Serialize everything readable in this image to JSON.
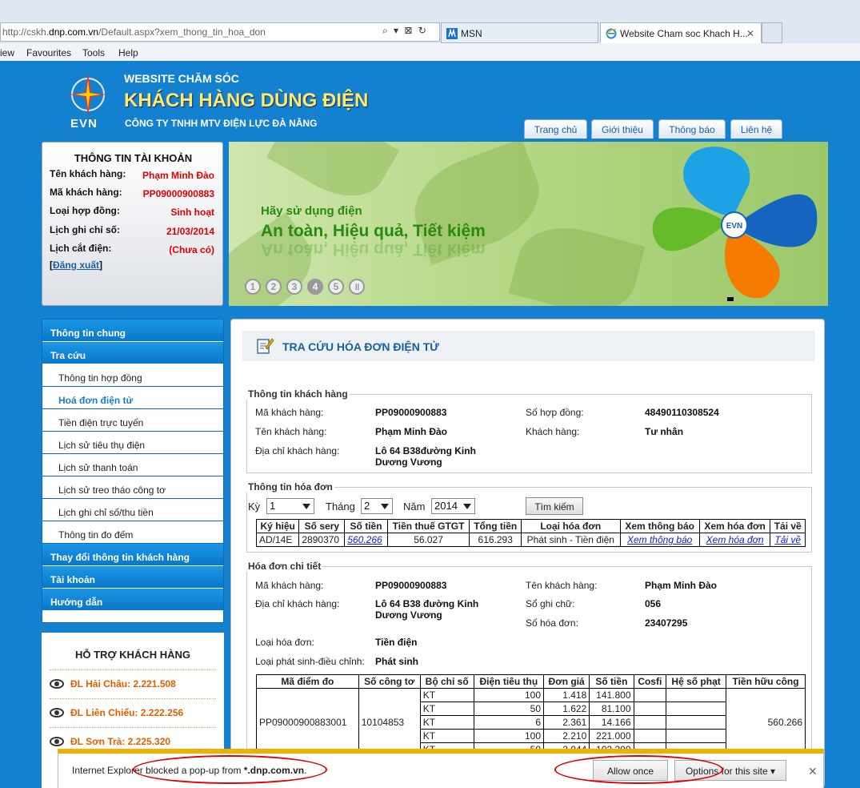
{
  "browser": {
    "address": {
      "prefix": "http://cskh.",
      "domain": "dnp.com.vn",
      "path": "/Default.aspx?xem_thong_tin_hoa_don"
    },
    "address_icons": "⌕ ▾ ⊠ ↻",
    "tabs": [
      {
        "label": "MSN",
        "icon": "msn-icon"
      },
      {
        "label": "Website Cham soc Khach H...",
        "icon": "ie-icon",
        "close": "✕"
      }
    ],
    "menu": [
      "iew",
      "Favourites",
      "Tools",
      "Help"
    ]
  },
  "header": {
    "logo_text": "EVN",
    "line1": "WEBSITE CHĂM SÓC",
    "line2": "KHÁCH HÀNG DÙNG ĐIỆN",
    "line3": "CÔNG TY TNHH MTV ĐIỆN LỰC ĐÀ NẴNG",
    "nav": [
      "Trang chủ",
      "Giới thiệu",
      "Thông báo",
      "Liên hệ"
    ]
  },
  "account": {
    "title": "THÔNG TIN TÀI KHOẢN",
    "rows": [
      {
        "label": "Tên khách hàng:",
        "value": "Phạm Minh Đào"
      },
      {
        "label": "Mã khách hàng:",
        "value": "PP09000900883"
      },
      {
        "label": "Loại hợp đồng:",
        "value": "Sinh hoạt"
      },
      {
        "label": "Lịch ghi chỉ số:",
        "value": "21/03/2014"
      },
      {
        "label": "Lịch cắt điện:",
        "value": "(Chưa có)"
      }
    ],
    "logout_open": "[",
    "logout": "Đăng xuất",
    "logout_close": "]"
  },
  "banner": {
    "line1": "Hãy sử dụng điện",
    "line2": "An toàn, Hiệu quả, Tiết kiệm",
    "dots": [
      "1",
      "2",
      "3",
      "4",
      "5",
      "॥"
    ],
    "active_dot": 4,
    "graphic_center": "EVN"
  },
  "sidebar": {
    "items": [
      {
        "label": "Thông tin chung",
        "type": "head"
      },
      {
        "label": "Tra cứu",
        "type": "head"
      },
      {
        "label": "Thông tin hợp đồng",
        "type": "sub"
      },
      {
        "label": "Hoá đơn điện tử",
        "type": "sub",
        "active": true
      },
      {
        "label": "Tiền điện trực tuyến",
        "type": "sub"
      },
      {
        "label": "Lịch sử tiêu thụ điện",
        "type": "sub"
      },
      {
        "label": "Lịch sử thanh toán",
        "type": "sub"
      },
      {
        "label": "Lịch sử treo tháo công tơ",
        "type": "sub"
      },
      {
        "label": "Lịch ghi chỉ số/thu tiền",
        "type": "sub"
      },
      {
        "label": "Thông tin đo đếm",
        "type": "sub"
      },
      {
        "label": "Thay đổi thông tin khách hàng",
        "type": "head"
      },
      {
        "label": "Tài khoản",
        "type": "head"
      },
      {
        "label": "Hướng dẫn",
        "type": "head"
      }
    ]
  },
  "support": {
    "title": "HỖ TRỢ KHÁCH HÀNG",
    "rows": [
      "ĐL Hải Châu: 2.221.508",
      "ĐL Liên Chiểu: 2.222.256",
      "ĐL Sơn Trà: 2.225.320"
    ]
  },
  "main": {
    "title": "TRA CỨU HÓA ĐƠN ĐIỆN TỬ",
    "customer": {
      "legend": "Thông tin khách hàng",
      "ma_kh_label": "Mã khách hàng:",
      "ma_kh": "PP09000900883",
      "so_hd_label": "Số hợp đồng:",
      "so_hd": "48490110308524",
      "ten_kh_label": "Tên khách hàng:",
      "ten_kh": "Phạm Minh Đào",
      "loai_kh_label": "Khách hàng:",
      "loai_kh": "Tư nhân",
      "dia_chi_label": "Địa chỉ khách hàng:",
      "dia_chi_1": "Lô 64 B38đường Kinh",
      "dia_chi_2": "Dương Vương"
    },
    "invoice": {
      "legend": "Thông tin hóa đơn",
      "ky_label": "Kỳ",
      "ky": "1",
      "thang_label": "Tháng",
      "thang": "2",
      "nam_label": "Năm",
      "nam": "2014",
      "search": "Tìm kiếm",
      "headers": [
        "Ký hiệu",
        "Số sery",
        "Số tiền",
        "Tiền thuế GTGT",
        "Tổng tiền",
        "Loại hóa đơn",
        "Xem thông báo",
        "Xem hóa đơn",
        "Tải về"
      ],
      "row": [
        "AD/14E",
        "2890370",
        "560.266",
        "56.027",
        "616.293",
        "Phát sinh - Tiền điện",
        "Xem thông báo",
        "Xem hóa đơn",
        "Tải về"
      ]
    },
    "detail": {
      "legend": "Hóa đơn chi tiết",
      "ma_kh_label": "Mã khách hàng:",
      "ma_kh": "PP09000900883",
      "ten_kh_label": "Tên khách hàng:",
      "ten_kh": "Phạm Minh Đào",
      "dia_chi_label": "Địa chỉ khách hàng:",
      "dia_chi_1": "Lô 64 B38 đường Kinh",
      "dia_chi_2": "Dương Vương",
      "so_ghi_chu_label": "Sổ ghi chữ:",
      "so_ghi_chu": "056",
      "so_hoa_don_label": "Số hóa đơn:",
      "so_hoa_don": "23407295",
      "loai_hd_label": "Loại hóa đơn:",
      "loai_hd": "Tiền điện",
      "loai_ps_label": "Loại phát sinh-điều chỉnh:",
      "loai_ps": "Phát sinh",
      "headers": [
        "Mã điểm đo",
        "Số công tơ",
        "Bộ chỉ số",
        "Điện tiêu thụ",
        "Đơn giá",
        "Số tiền",
        "Cosfi",
        "Hệ số phạt",
        "Tiền hữu công"
      ],
      "ma_diem_do": "PP09000900883001",
      "so_cong_to": "10104853",
      "tien_huu_cong": "560.266",
      "rows": [
        [
          "KT",
          "100",
          "1.418",
          "141.800"
        ],
        [
          "KT",
          "50",
          "1.622",
          "81.100"
        ],
        [
          "KT",
          "6",
          "2.361",
          "14.166"
        ],
        [
          "KT",
          "100",
          "2.210",
          "221.000"
        ],
        [
          "KT",
          "50",
          "2.044",
          "102.200"
        ]
      ]
    }
  },
  "notification": {
    "text_pre": "Internet Explorer blocked a pop-up from ",
    "text_domain": "*.dnp.com.vn",
    "text_post": ".",
    "allow": "Allow once",
    "options": "Options for this site ▾",
    "close": "✕"
  }
}
